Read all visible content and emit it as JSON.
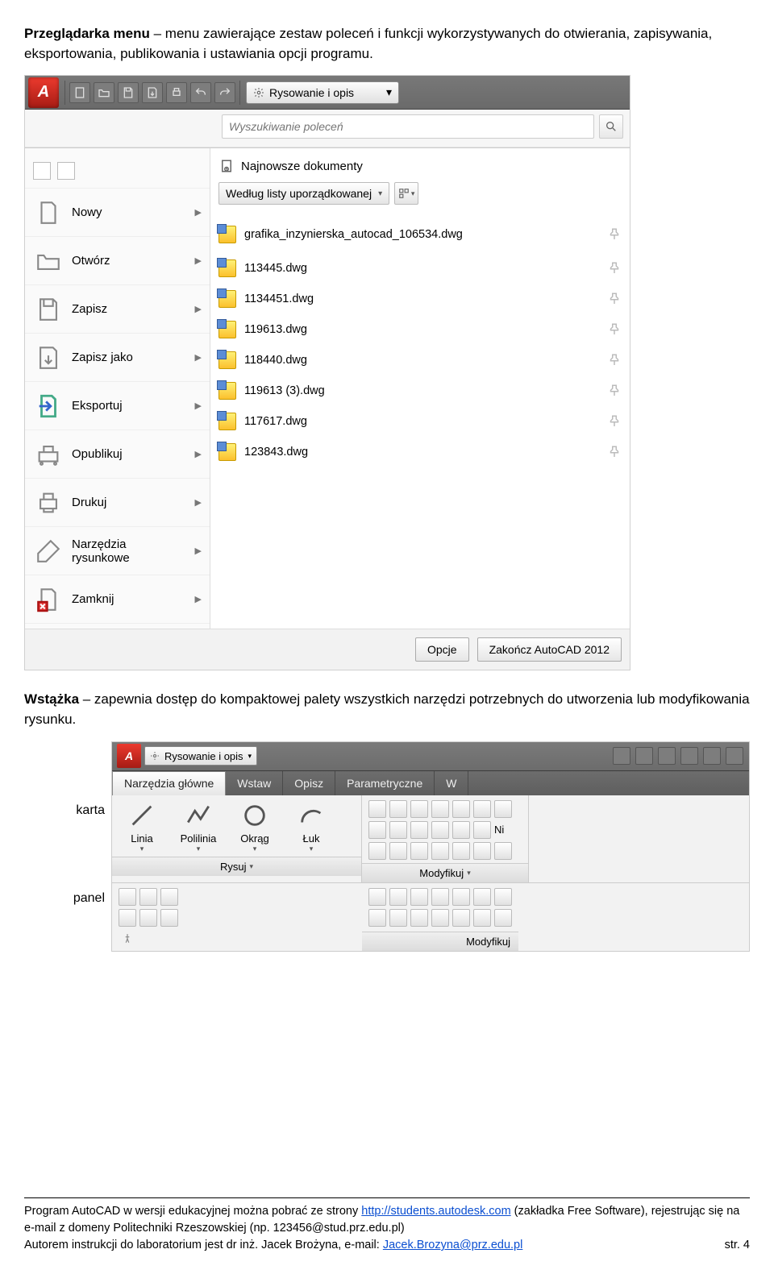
{
  "para1": {
    "bold": "Przeglądarka menu",
    "rest": " – menu zawierające zestaw poleceń i funkcji wykorzystywanych do otwierania, zapisywania, eksportowania, publikowania i ustawiania opcji programu."
  },
  "para2": {
    "bold": "Wstążka",
    "rest": " – zapewnia dostęp do kompaktowej palety wszystkich narzędzi potrzebnych do utworzenia lub modyfikowania rysunku."
  },
  "shot1": {
    "workspace": "Rysowanie i opis",
    "search_placeholder": "Wyszukiwanie poleceń",
    "menu_items": [
      "Nowy",
      "Otwórz",
      "Zapisz",
      "Zapisz jako",
      "Eksportuj",
      "Opublikuj",
      "Drukuj",
      "Narzędzia rysunkowe",
      "Zamknij"
    ],
    "recent_heading": "Najnowsze dokumenty",
    "sort_label": "Według listy uporządkowanej",
    "recent_docs": [
      "grafika_inzynierska_autocad_106534.dwg",
      "113445.dwg",
      "1134451.dwg",
      "119613.dwg",
      "118440.dwg",
      "119613 (3).dwg",
      "117617.dwg",
      "123843.dwg"
    ],
    "btn_options": "Opcje",
    "btn_exit": "Zakończ AutoCAD 2012"
  },
  "anno": {
    "karta": "karta",
    "panel": "panel"
  },
  "shot2": {
    "workspace": "Rysowanie i opis",
    "tabs": [
      "Narzędzia główne",
      "Wstaw",
      "Opisz",
      "Parametryczne",
      "W"
    ],
    "draw_tools": [
      "Linia",
      "Polilinia",
      "Okrąg",
      "Łuk"
    ],
    "panel_draw": "Rysuj",
    "panel_modify": "Modyfikuj",
    "modify_partial": "Ni"
  },
  "footer": {
    "l1a": "Program AutoCAD w wersji edukacyjnej można pobrać ze strony ",
    "l1_link": "http://students.autodesk.com",
    "l1b": " (zakładka Free Software), rejestrując się na",
    "l2": "e-mail z domeny Politechniki Rzeszowskiej (np. 123456@stud.prz.edu.pl)",
    "l3a": "Autorem instrukcji do laboratorium jest dr inż. Jacek Brożyna, e-mail: ",
    "l3_link": "Jacek.Brozyna@prz.edu.pl",
    "page": "str. 4"
  }
}
